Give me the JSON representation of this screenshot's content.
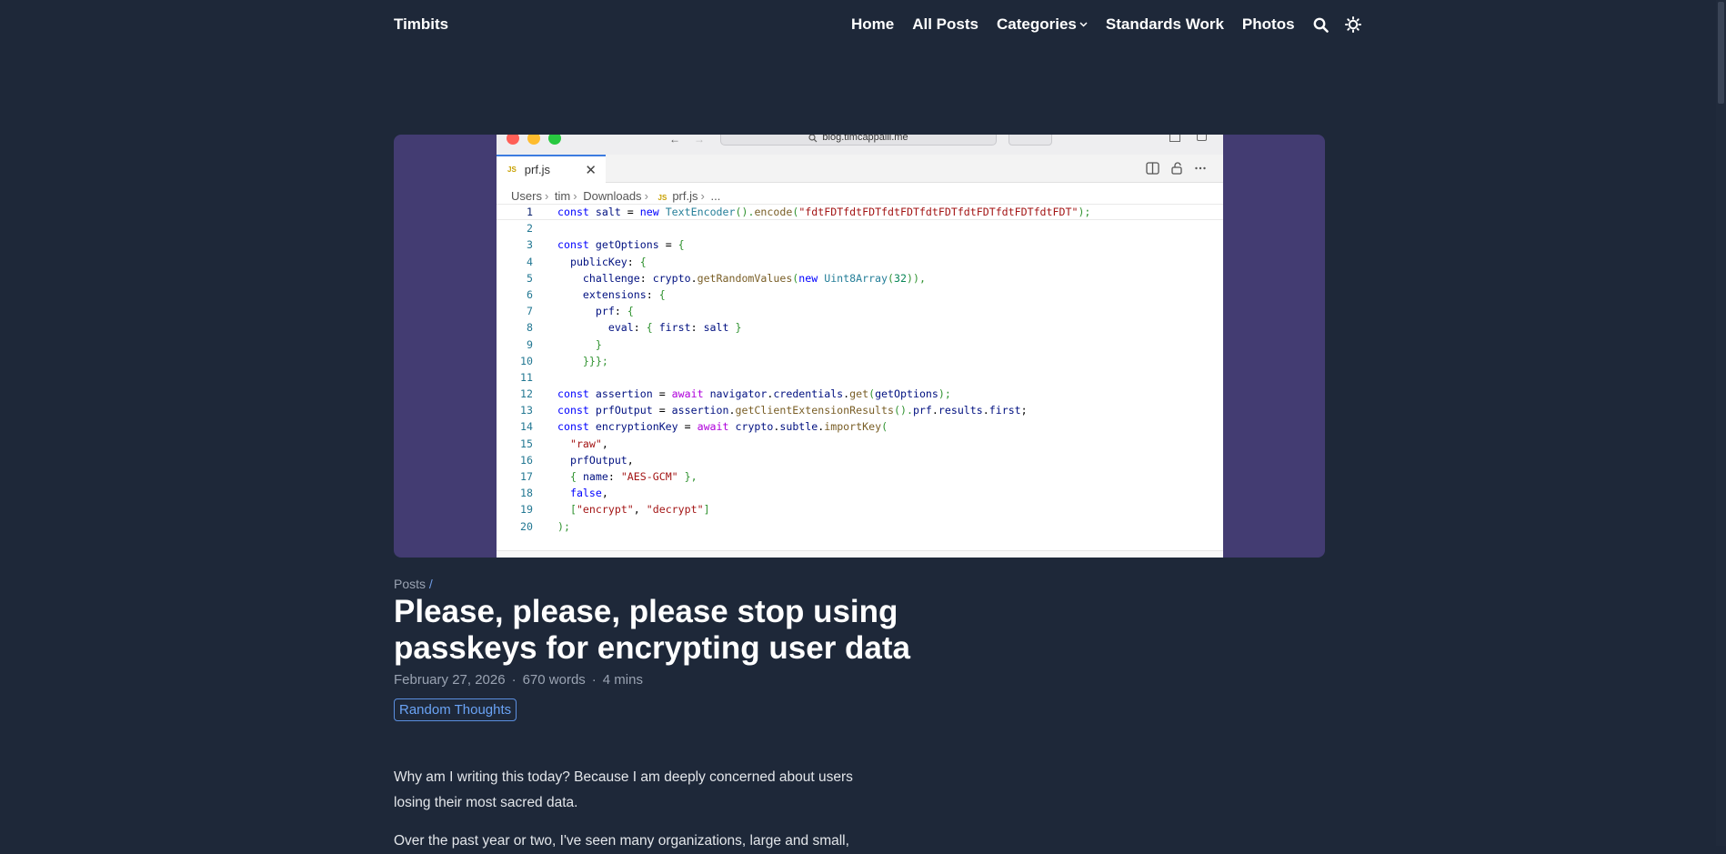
{
  "site": {
    "title": "Timbits"
  },
  "nav": {
    "home": "Home",
    "all_posts": "All Posts",
    "categories": "Categories",
    "standards_work": "Standards Work",
    "photos": "Photos"
  },
  "hero": {
    "browser_url": "blog.timcappalli.me",
    "tab_icon_text": "JS",
    "tab_label": "prf.js",
    "tab_close": "✕",
    "breadcrumb": [
      "Users",
      "tim",
      "Downloads",
      "prf.js",
      "..."
    ],
    "line_numbers": [
      "1",
      "2",
      "3",
      "4",
      "5",
      "6",
      "7",
      "8",
      "9",
      "10",
      "11",
      "12",
      "13",
      "14",
      "15",
      "16",
      "17",
      "18",
      "19",
      "20"
    ],
    "code_lines": [
      "const salt = new TextEncoder().encode(\"fdtFDTfdtFDTfdtFDTfdtFDTfdtFDTfdtFDTfdtFDT\");",
      "",
      "const getOptions = {",
      "  publicKey: {",
      "    challenge: crypto.getRandomValues(new Uint8Array(32)),",
      "    extensions: {",
      "      prf: {",
      "        eval: { first: salt }",
      "      }",
      "    }}};",
      "",
      "const assertion = await navigator.credentials.get(getOptions);",
      "const prfOutput = assertion.getClientExtensionResults().prf.results.first;",
      "const encryptionKey = await crypto.subtle.importKey(",
      "  \"raw\",",
      "  prfOutput,",
      "  { name: \"AES-GCM\" },",
      "  false,",
      "  [\"encrypt\", \"decrypt\"]",
      ");"
    ]
  },
  "article": {
    "breadcrumb": "Posts",
    "breadcrumb_sep": "/",
    "title": "Please, please, please stop using passkeys for encrypting user data",
    "date": "February 27, 2026",
    "words": "670 words",
    "read_time": "4 mins",
    "meta_sep": "·",
    "tag": "Random Thoughts",
    "paragraphs": [
      "Why am I writing this today? Because I am deeply concerned about users losing their most sacred data.",
      "Over the past year or two, I've seen many organizations, large and small,"
    ]
  },
  "colors": {
    "background": "#1e2839",
    "hero_background": "#433c72",
    "accent": "#6aa3f5"
  },
  "icons": [
    "search-icon",
    "theme-toggle-icon",
    "chevron-down-icon",
    "split-editor-icon",
    "lock-icon",
    "more-icon"
  ]
}
